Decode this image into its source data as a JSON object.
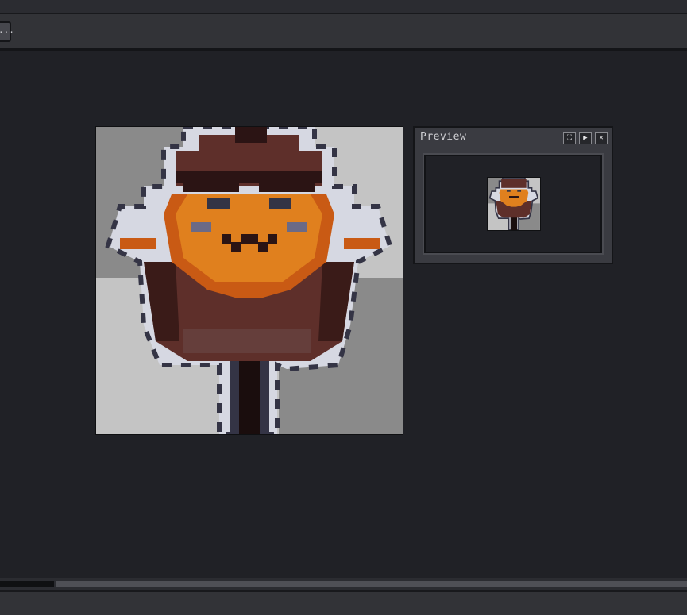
{
  "tabbar": {
    "more_label": "..."
  },
  "preview": {
    "title": "Preview",
    "buttons": [
      {
        "icon": "fit-screen-icon",
        "glyph": "⛶"
      },
      {
        "icon": "play-icon",
        "glyph": "▶"
      },
      {
        "icon": "close-icon",
        "glyph": "✕"
      }
    ]
  },
  "colors": {
    "background": "#202126",
    "panel": "#3a3b41",
    "orange": "#e0801e",
    "dark_orange": "#c95a14",
    "brown": "#5e2f2a",
    "dark_brown": "#2b1414",
    "outline": "#d6d8e2",
    "outline_dark": "#343445"
  }
}
